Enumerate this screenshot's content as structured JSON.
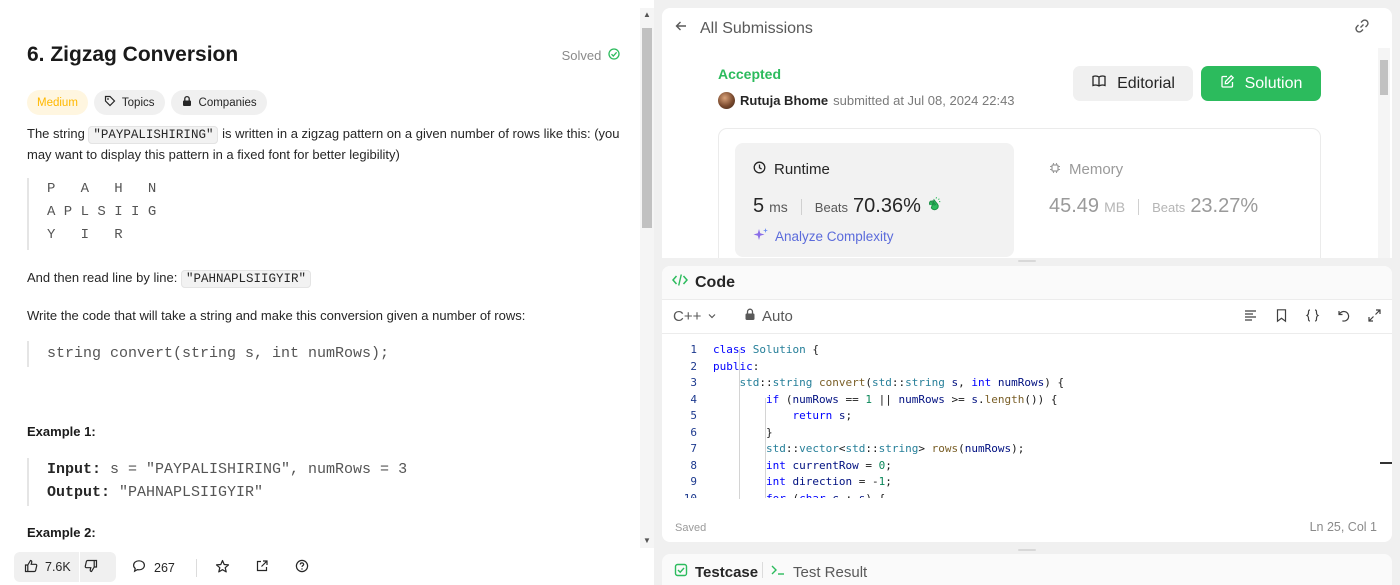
{
  "problem": {
    "title": "6. Zigzag Conversion",
    "solved_label": "Solved",
    "tags": [
      "Medium",
      "Topics",
      "Companies"
    ],
    "desc_pre": "The string ",
    "desc_code": "\"PAYPALISHIRING\"",
    "desc_post": " is written in a zigzag pattern on a given number of rows like this: (you may want to display this pattern in a fixed font for better legibility)",
    "zigzag": "P   A   H   N\nA P L S I I G\nY   I   R",
    "read_pre": "And then read line by line: ",
    "read_code": "\"PAHNAPLSIIGYIR\"",
    "write_text": "Write the code that will take a string and make this conversion given a number of rows:",
    "signature": "string convert(string s, int numRows);",
    "example1_h": "Example 1:",
    "ex1_input_label": "Input:",
    "ex1_input": " s = \"PAYPALISHIRING\", numRows = 3",
    "ex1_output_label": "Output:",
    "ex1_output": " \"PAHNAPLSIIGYIR\"",
    "example2_h": "Example 2:"
  },
  "bottom_bar": {
    "likes": "7.6K",
    "comments": "267"
  },
  "submission": {
    "back_label": "All Submissions",
    "status": "Accepted",
    "user": "Rutuja Bhome",
    "submitted_text": "submitted at Jul 08, 2024 22:43",
    "editorial_label": "Editorial",
    "solution_label": "Solution",
    "runtime_label": "Runtime",
    "runtime_value": "5",
    "runtime_unit": "ms",
    "beats_label": "Beats",
    "runtime_beats": "70.36%",
    "analyze_label": "Analyze Complexity",
    "memory_label": "Memory",
    "memory_value": "45.49",
    "memory_unit": "MB",
    "memory_beats": "23.27%"
  },
  "code_panel": {
    "title": "Code",
    "language": "C++",
    "mode": "Auto",
    "saved": "Saved",
    "cursor": "Ln 25, Col 1",
    "line_numbers": [
      "1",
      "2",
      "3",
      "4",
      "5",
      "6",
      "7",
      "8",
      "9",
      "10"
    ]
  },
  "bottom_tabs": {
    "testcase": "Testcase",
    "test_result": "Test Result"
  },
  "colors": {
    "accent_green": "#2cbb5d",
    "medium_yellow": "#ffb800",
    "analyze_purple": "#5b6bdb"
  }
}
